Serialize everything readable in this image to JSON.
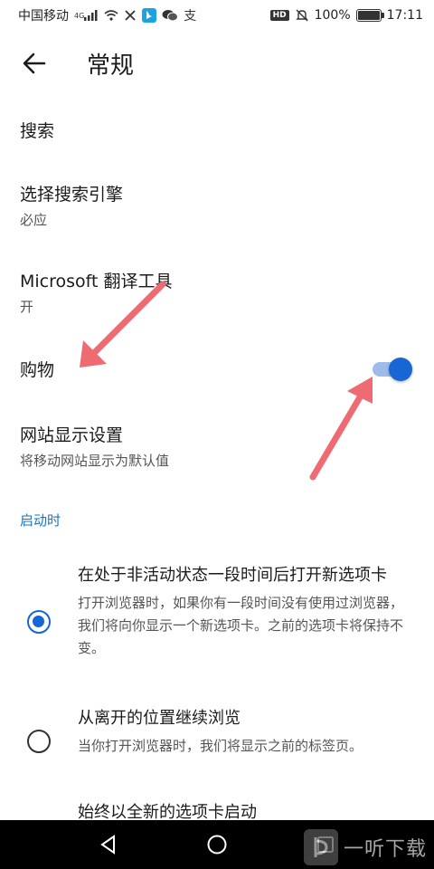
{
  "status_bar": {
    "carrier": "中国移动",
    "network": "4G",
    "battery": "100%",
    "battery_fill": 1.0,
    "time": "17:11",
    "hd": "HD"
  },
  "app_bar": {
    "back_icon": "arrow-back-icon",
    "title": "常规"
  },
  "settings": {
    "search": {
      "title": "搜索"
    },
    "search_engine": {
      "title": "选择搜索引擎",
      "value": "必应"
    },
    "translator": {
      "title": "Microsoft 翻译工具",
      "value": "开"
    },
    "shopping": {
      "title": "购物",
      "enabled": true
    },
    "site_display": {
      "title": "网站显示设置",
      "subtitle": "将移动网站显示为默认值"
    }
  },
  "startup": {
    "header": "启动时",
    "options": [
      {
        "title": "在处于非活动状态一段时间后打开新选项卡",
        "description": "打开浏览器时，如果你有一段时间没有使用过浏览器，我们将向你显示一个新选项卡。之前的选项卡将保持不变。",
        "selected": true
      },
      {
        "title": "从离开的位置继续浏览",
        "description": "当你打开浏览器时，我们将显示之前的标签页。",
        "selected": false
      },
      {
        "title": "始终以全新的选项卡启动",
        "selected": false
      }
    ]
  },
  "watermark": {
    "text": "一听下载"
  },
  "colors": {
    "accent": "#1766d4",
    "toggle_track": "#9dbde8",
    "section_header": "#1a73c8",
    "annotation_arrow": "#ef6b73",
    "text_primary": "#1b1b1b",
    "text_secondary": "#555555"
  }
}
